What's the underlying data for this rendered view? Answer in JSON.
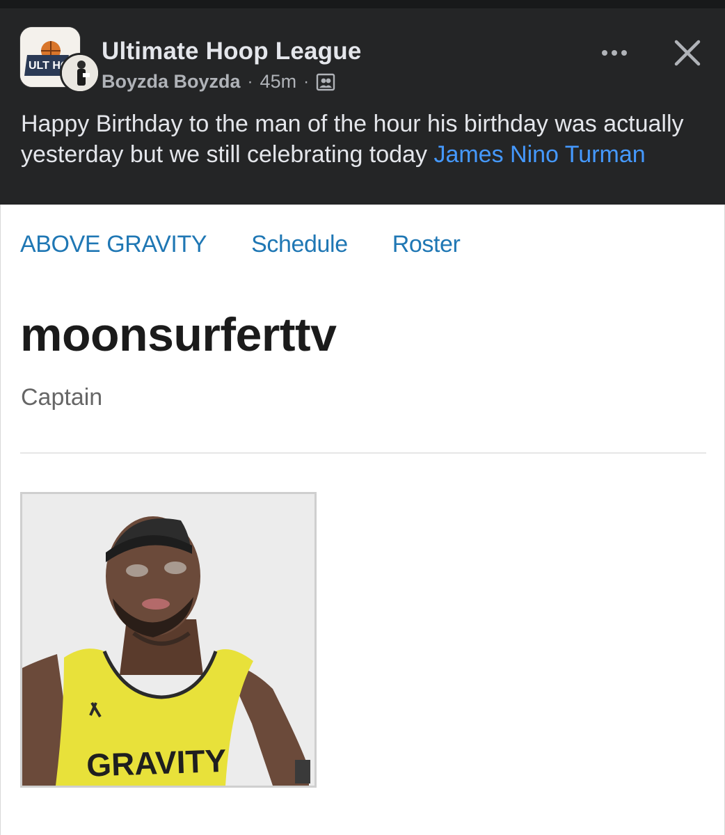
{
  "post": {
    "group_name": "Ultimate Hoop League",
    "author": "Boyzda Boyzda",
    "time": "45m",
    "separator": "·",
    "audience_icon": "group-audience-icon",
    "text_before_mention": "Happy Birthday to the man of the hour his birthday was actually yesterday but we still celebrating today ",
    "mention": "James Nino Turman",
    "logo_text": "ULT HOO"
  },
  "page": {
    "nav": [
      "ABOVE GRAVITY",
      "Schedule",
      "Roster"
    ],
    "player_name": "moonsurferttv",
    "player_role": "Captain",
    "jersey_text": "GRAVITY"
  },
  "colors": {
    "header_bg": "#242526",
    "mention": "#4599ff",
    "nav_link": "#1f77b4",
    "jersey": "#e8e13a"
  }
}
